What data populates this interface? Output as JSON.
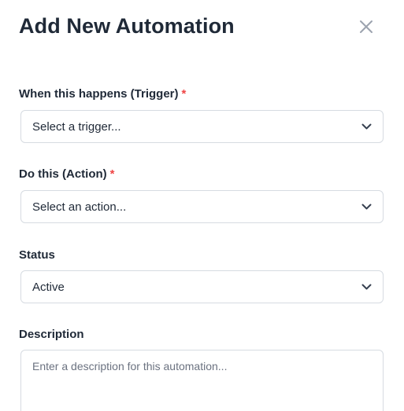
{
  "modal": {
    "title": "Add New Automation",
    "close_icon": "close-icon"
  },
  "form": {
    "trigger": {
      "label": "When this happens (Trigger)",
      "required_mark": "*",
      "selected": "Select a trigger...",
      "icon": "chevron-down-icon"
    },
    "action": {
      "label": "Do this (Action)",
      "required_mark": "*",
      "selected": "Select an action...",
      "icon": "chevron-down-icon"
    },
    "status": {
      "label": "Status",
      "selected": "Active",
      "icon": "chevron-down-icon"
    },
    "description": {
      "label": "Description",
      "placeholder": "Enter a description for this automation...",
      "value": ""
    }
  },
  "colors": {
    "required": "#ef4444",
    "border": "#d6dbe1",
    "text": "#1f2937",
    "placeholder": "#6b7280",
    "icon": "#9ca3af"
  }
}
